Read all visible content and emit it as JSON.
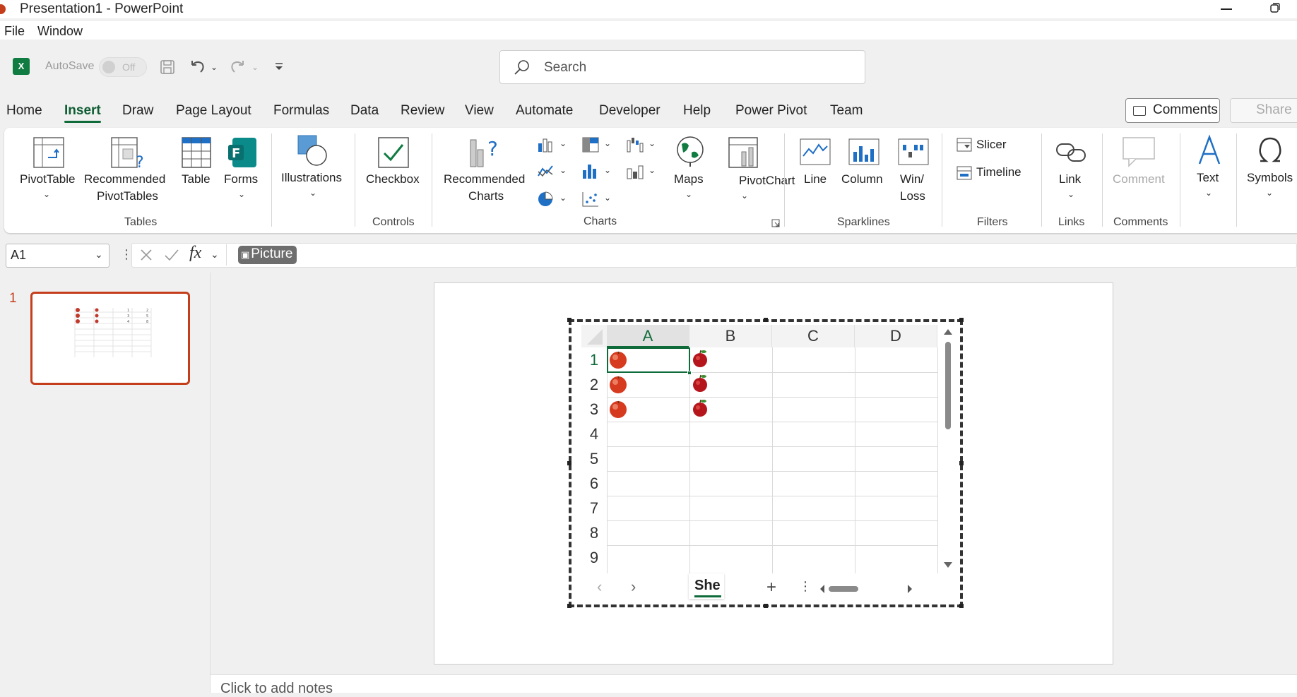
{
  "window": {
    "title": "Presentation1 - PowerPoint"
  },
  "menu": {
    "file": "File",
    "window": "Window"
  },
  "qat": {
    "autosave_label": "AutoSave",
    "autosave_state": "Off"
  },
  "search": {
    "placeholder": "Search"
  },
  "tabs": [
    "Home",
    "Insert",
    "Draw",
    "Page Layout",
    "Formulas",
    "Data",
    "Review",
    "View",
    "Automate",
    "Developer",
    "Help",
    "Power Pivot",
    "Team"
  ],
  "active_tab": "Insert",
  "header_buttons": {
    "comments": "Comments",
    "share": "Share"
  },
  "ribbon": {
    "pivottable": "PivotTable",
    "recommended_pivottables_1": "Recommended",
    "recommended_pivottables_2": "PivotTables",
    "table": "Table",
    "forms": "Forms",
    "illustrations": "Illustrations",
    "checkbox": "Checkbox",
    "recommended_charts_1": "Recommended",
    "recommended_charts_2": "Charts",
    "maps": "Maps",
    "pivotchart": "PivotChart",
    "line": "Line",
    "column": "Column",
    "winloss_1": "Win/",
    "winloss_2": "Loss",
    "slicer": "Slicer",
    "timeline": "Timeline",
    "link": "Link",
    "comment": "Comment",
    "text": "Text",
    "symbols": "Symbols",
    "groups": {
      "tables": "Tables",
      "controls": "Controls",
      "charts": "Charts",
      "sparklines": "Sparklines",
      "filters": "Filters",
      "links": "Links",
      "comments": "Comments"
    }
  },
  "formula": {
    "namebox": "A1",
    "fx": "fx",
    "content": "Picture"
  },
  "slides": {
    "current_number": "1"
  },
  "notes": {
    "placeholder": "Click to add notes"
  },
  "sheet": {
    "columns": [
      "A",
      "B",
      "C",
      "D"
    ],
    "rows": [
      "1",
      "2",
      "3",
      "4",
      "5",
      "6",
      "7",
      "8",
      "9"
    ],
    "tab_name": "She",
    "selected_cell": "A1"
  },
  "colors": {
    "accent_green": "#0f6b3a",
    "accent_orange": "#c43e1c",
    "excel_green": "#107c41"
  }
}
